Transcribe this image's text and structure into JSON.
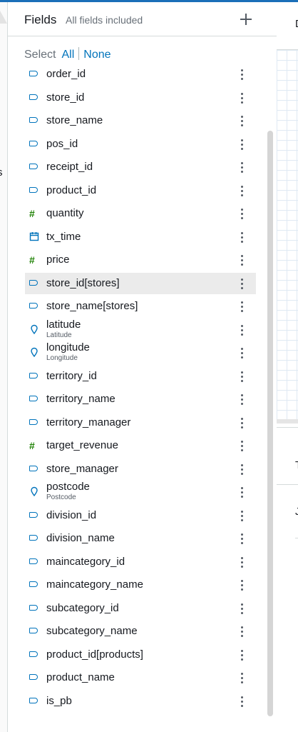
{
  "panel": {
    "title": "Fields",
    "subtitle": "All fields included",
    "select_label": "Select",
    "select_all": "All",
    "select_none": "None"
  },
  "fields": [
    {
      "name": "order_id",
      "type": "dimension",
      "sub": ""
    },
    {
      "name": "store_id",
      "type": "dimension",
      "sub": ""
    },
    {
      "name": "store_name",
      "type": "dimension",
      "sub": ""
    },
    {
      "name": "pos_id",
      "type": "dimension",
      "sub": ""
    },
    {
      "name": "receipt_id",
      "type": "dimension",
      "sub": ""
    },
    {
      "name": "product_id",
      "type": "dimension",
      "sub": ""
    },
    {
      "name": "quantity",
      "type": "measure",
      "sub": ""
    },
    {
      "name": "tx_time",
      "type": "date",
      "sub": ""
    },
    {
      "name": "price",
      "type": "measure",
      "sub": ""
    },
    {
      "name": "store_id[stores]",
      "type": "dimension",
      "sub": "",
      "selected": true
    },
    {
      "name": "store_name[stores]",
      "type": "dimension",
      "sub": ""
    },
    {
      "name": "latitude",
      "type": "geo",
      "sub": "Latitude"
    },
    {
      "name": "longitude",
      "type": "geo",
      "sub": "Longitude"
    },
    {
      "name": "territory_id",
      "type": "dimension",
      "sub": ""
    },
    {
      "name": "territory_name",
      "type": "dimension",
      "sub": ""
    },
    {
      "name": "territory_manager",
      "type": "dimension",
      "sub": ""
    },
    {
      "name": "target_revenue",
      "type": "measure",
      "sub": ""
    },
    {
      "name": "store_manager",
      "type": "dimension",
      "sub": ""
    },
    {
      "name": "postcode",
      "type": "geo",
      "sub": "Postcode"
    },
    {
      "name": "division_id",
      "type": "dimension",
      "sub": ""
    },
    {
      "name": "division_name",
      "type": "dimension",
      "sub": ""
    },
    {
      "name": "maincategory_id",
      "type": "dimension",
      "sub": ""
    },
    {
      "name": "maincategory_name",
      "type": "dimension",
      "sub": ""
    },
    {
      "name": "subcategory_id",
      "type": "dimension",
      "sub": ""
    },
    {
      "name": "subcategory_name",
      "type": "dimension",
      "sub": ""
    },
    {
      "name": "product_id[products]",
      "type": "dimension",
      "sub": ""
    },
    {
      "name": "product_name",
      "type": "dimension",
      "sub": ""
    },
    {
      "name": "is_pb",
      "type": "dimension",
      "sub": ""
    }
  ],
  "right_clipped": {
    "top_char": "D",
    "mid_char": "T",
    "low_char": "J"
  },
  "left_clipped": {
    "char": "s"
  },
  "colors": {
    "dimension": "#0073bb",
    "measure": "#1d8102",
    "accent": "#0073bb",
    "selected_row": "#ebebeb"
  }
}
